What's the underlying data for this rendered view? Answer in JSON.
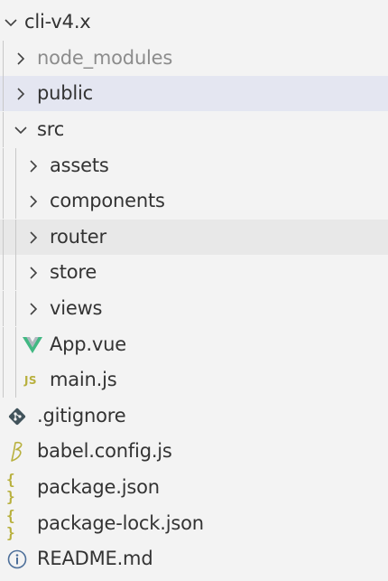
{
  "tree": {
    "root": {
      "label": "cli-v4.x",
      "expanded": true,
      "icon": "chevron-down-icon"
    },
    "items": [
      {
        "label": "node_modules",
        "kind": "folder",
        "expanded": false,
        "icon": "chevron-right-icon",
        "dimmed": true
      },
      {
        "label": "public",
        "kind": "folder",
        "expanded": false,
        "icon": "chevron-right-icon",
        "selected": true
      },
      {
        "label": "src",
        "kind": "folder",
        "expanded": true,
        "icon": "chevron-down-icon"
      },
      {
        "label": "assets",
        "kind": "folder",
        "expanded": false,
        "icon": "chevron-right-icon"
      },
      {
        "label": "components",
        "kind": "folder",
        "expanded": false,
        "icon": "chevron-right-icon"
      },
      {
        "label": "router",
        "kind": "folder",
        "expanded": false,
        "icon": "chevron-right-icon",
        "hovered": true
      },
      {
        "label": "store",
        "kind": "folder",
        "expanded": false,
        "icon": "chevron-right-icon"
      },
      {
        "label": "views",
        "kind": "folder",
        "expanded": false,
        "icon": "chevron-right-icon"
      },
      {
        "label": "App.vue",
        "kind": "file",
        "icon": "vue-icon"
      },
      {
        "label": "main.js",
        "kind": "file",
        "icon": "javascript-icon",
        "icon_text": "JS"
      },
      {
        "label": ".gitignore",
        "kind": "file",
        "icon": "git-icon"
      },
      {
        "label": "babel.config.js",
        "kind": "file",
        "icon": "babel-icon"
      },
      {
        "label": "package.json",
        "kind": "file",
        "icon": "json-icon",
        "icon_text": "{ }"
      },
      {
        "label": "package-lock.json",
        "kind": "file",
        "icon": "json-icon",
        "icon_text": "{ }"
      },
      {
        "label": "README.md",
        "kind": "file",
        "icon": "info-icon"
      }
    ]
  },
  "colors": {
    "background": "#f3f3f3",
    "selected_row": "#e4e6f1",
    "hovered_row": "#e8e8e8",
    "text": "#333333",
    "dimmed_text": "#8c8c8c",
    "vue_green": "#41b883",
    "json_yellow": "#b8b03d",
    "info_blue": "#4d6f9a",
    "git_dark": "#41535b"
  }
}
